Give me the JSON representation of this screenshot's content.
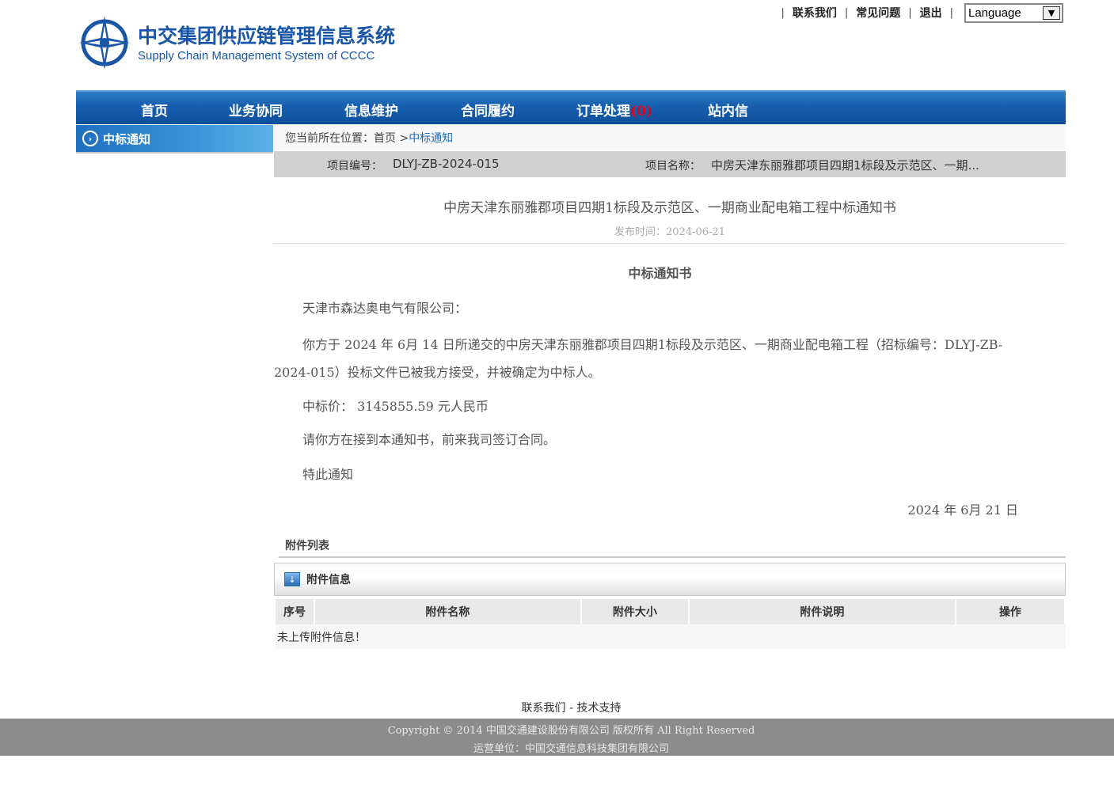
{
  "header": {
    "logo_cn": "中交集团供应链管理信息系统",
    "logo_en": "Supply Chain Management System of CCCC",
    "links": {
      "contact": "联系我们",
      "faq": "常见问题",
      "logout": "退出"
    },
    "separator": "|",
    "language_select": {
      "value": "Language"
    }
  },
  "nav": {
    "items": [
      {
        "label": "首页"
      },
      {
        "label": "业务协同"
      },
      {
        "label": "信息维护"
      },
      {
        "label": "合同履约"
      },
      {
        "label": "订单处理",
        "badge": "(0)"
      },
      {
        "label": "站内信"
      }
    ]
  },
  "sidebar": {
    "title": "中标通知"
  },
  "breadcrumb": {
    "prefix": "您当前所在位置：首页 > ",
    "current": "中标通知"
  },
  "project": {
    "code_label": "项目编号：",
    "code": "DLYJ-ZB-2024-015",
    "name_label": "项目名称：",
    "name": "中房天津东丽雅郡项目四期1标段及示范区、一期..."
  },
  "article": {
    "title": "中房天津东丽雅郡项目四期1标段及示范区、一期商业配电箱工程中标通知书",
    "publish": "发布时间：2024-06-21",
    "doc_heading": "中标通知书",
    "recipient": "天津市森达奥电气有限公司：",
    "body": "你方于 2024 年 6月 14 日所递交的中房天津东丽雅郡项目四期1标段及示范区、一期商业配电箱工程（招标编号：DLYJ-ZB-2024-015）投标文件已被我方接受，并被确定为中标人。",
    "price": "中标价：  3145855.59 元人民币",
    "request": "请你方在接到本通知书，前来我司签订合同。",
    "notice": "特此通知",
    "sign_date": "2024 年 6月 21 日"
  },
  "attachments": {
    "list_title": "附件列表",
    "info_title": "附件信息",
    "columns": [
      "序号",
      "附件名称",
      "附件大小",
      "附件说明",
      "操作"
    ],
    "empty_text": "未上传附件信息！"
  },
  "footer": {
    "links": "联系我们 - 技术支持",
    "copyright": "Copyright © 2014 中国交通建设股份有限公司 版权所有 All Right Reserved",
    "operator": "运营单位：中国交通信息科技集团有限公司"
  },
  "colors": {
    "brand_blue": "#1a56a8",
    "nav_blue": "#1861b0",
    "badge_red": "#e60012",
    "link_blue": "#1a6bb8"
  }
}
